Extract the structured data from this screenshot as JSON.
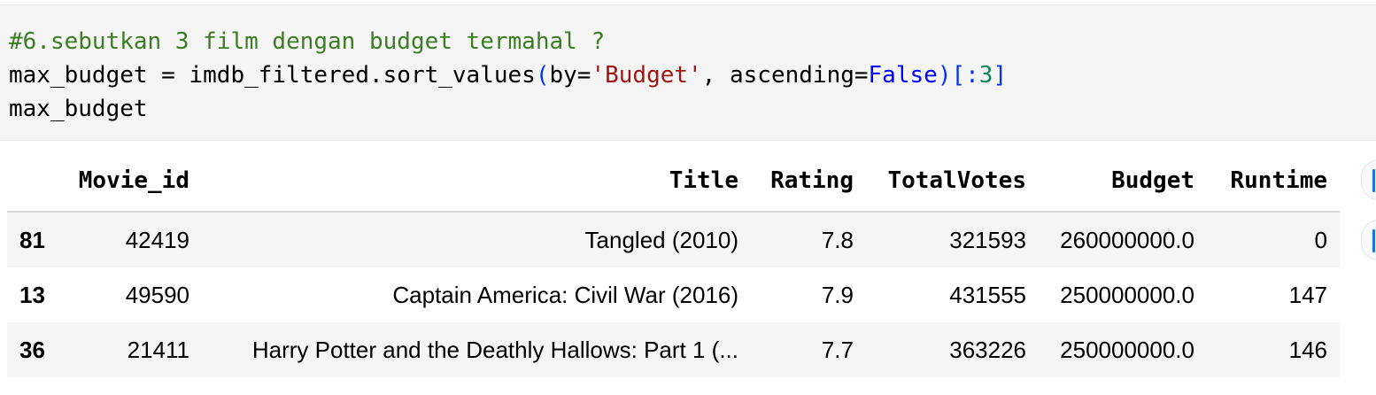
{
  "code": {
    "comment": "#6.sebutkan 3 film dengan budget termahal ?",
    "line2": {
      "t1": "max_budget = imdb_filtered.sort_values",
      "t2": "(",
      "t3": "by=",
      "t4": "'Budget'",
      "t5": ", ascending=",
      "t6": "False",
      "t7": ")[:",
      "t8": "3",
      "t9": "]"
    },
    "line3": "max_budget"
  },
  "table": {
    "columns": [
      "",
      "Movie_id",
      "Title",
      "Rating",
      "TotalVotes",
      "Budget",
      "Runtime"
    ],
    "rows": [
      {
        "index": "81",
        "movie_id": "42419",
        "title": "Tangled (2010)",
        "rating": "7.8",
        "total_votes": "321593",
        "budget": "260000000.0",
        "runtime": "0"
      },
      {
        "index": "13",
        "movie_id": "49590",
        "title": "Captain America: Civil War (2016)",
        "rating": "7.9",
        "total_votes": "431555",
        "budget": "250000000.0",
        "runtime": "147"
      },
      {
        "index": "36",
        "movie_id": "21411",
        "title": "Harry Potter and the Deathly Hallows: Part 1 (...",
        "rating": "7.7",
        "total_votes": "363226",
        "budget": "250000000.0",
        "runtime": "146"
      }
    ]
  },
  "colors": {
    "comment": "#3b7d23",
    "string": "#a31515",
    "keyword": "#0000ff",
    "number": "#098658",
    "accent": "#1a73e8"
  }
}
